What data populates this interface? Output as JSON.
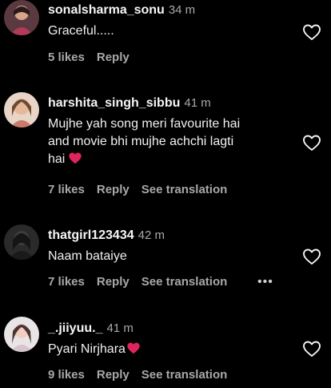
{
  "comments": [
    {
      "username": "sonalsharma_sonu",
      "time": "34 m",
      "text": "Graceful.....",
      "likes": "5 likes",
      "reply": "Reply",
      "translation": ""
    },
    {
      "username": "harshita_singh_sibbu",
      "time": "41 m",
      "text_lines": [
        "Mujhe yah song meri favourite hai",
        "and movie bhi mujhe achchi lagti",
        "hai"
      ],
      "likes": "7 likes",
      "reply": "Reply",
      "translation": "See translation"
    },
    {
      "username": "thatgirl123434",
      "time": "42 m",
      "text": "Naam bataiye",
      "likes": "7 likes",
      "reply": "Reply",
      "translation": "See translation",
      "more": "•••"
    },
    {
      "username": "_.jiiyuu._",
      "time": "41 m",
      "text": "Pyari Nirjhara",
      "likes": "9 likes",
      "reply": "Reply",
      "translation": "See translation"
    }
  ],
  "icons": {
    "like": "heart-outline-icon",
    "emoji": "red-heart-emoji",
    "more": "more-options-icon"
  },
  "colors": {
    "background": "#000000",
    "primary_text": "#f5f5f5",
    "secondary_text": "#a8a8a8",
    "heart_emoji": "#e0245e"
  }
}
